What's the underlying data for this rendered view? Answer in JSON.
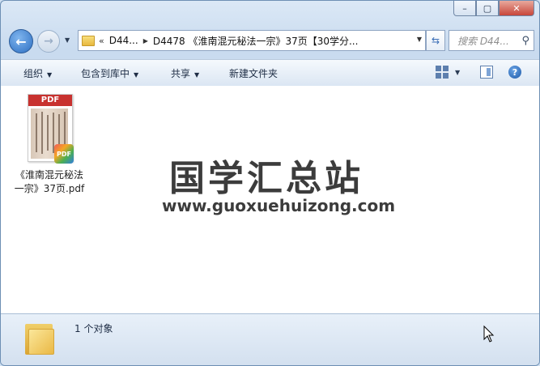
{
  "window": {
    "caption": {
      "minimize": "–",
      "maximize": "▢",
      "close": "✕"
    }
  },
  "nav": {
    "back_glyph": "←",
    "forward_glyph": "→",
    "address": {
      "overflow": "«",
      "crumb1": "D44...",
      "crumb2": "D4478 《淮南混元秘法一宗》37页【30学分..."
    },
    "search_placeholder": "搜索 D44..."
  },
  "toolbar": {
    "organize": "组织",
    "include_in_library": "包含到库中",
    "share": "共享",
    "new_folder": "新建文件夹"
  },
  "files": [
    {
      "name_line1": "《淮南混元秘法",
      "name_line2": "一宗》37页.pdf",
      "thumb_label": "PDF",
      "badge_label": "PDF"
    }
  ],
  "watermark": {
    "title": "国学汇总站",
    "url": "www.guoxuehuizong.com"
  },
  "details": {
    "count_text": "1 个对象"
  },
  "colors": {
    "pdf_red": "#c8322f",
    "accent_blue": "#2d6fc2",
    "close_red": "#c7463a"
  }
}
